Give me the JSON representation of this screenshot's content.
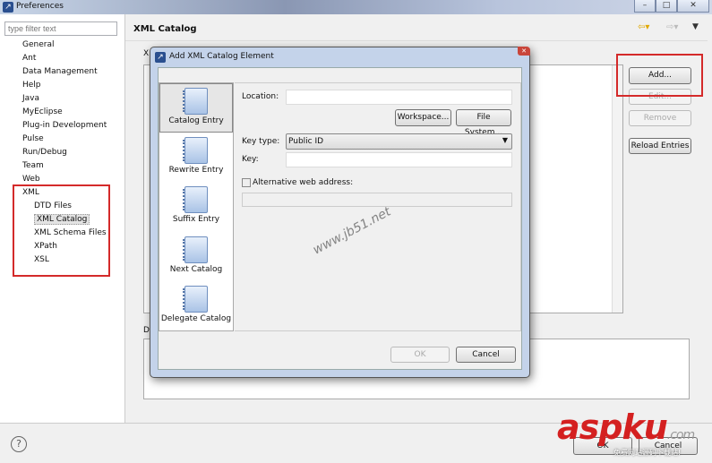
{
  "window": {
    "title": "Preferences",
    "minimize": "–",
    "maximize": "□",
    "close": "✕"
  },
  "sidebar": {
    "filter_placeholder": "type filter text",
    "items": [
      {
        "label": "General"
      },
      {
        "label": "Ant"
      },
      {
        "label": "Data Management"
      },
      {
        "label": "Help"
      },
      {
        "label": "Java"
      },
      {
        "label": "MyEclipse"
      },
      {
        "label": "Plug-in Development"
      },
      {
        "label": "Pulse"
      },
      {
        "label": "Run/Debug"
      },
      {
        "label": "Team"
      },
      {
        "label": "Web"
      },
      {
        "label": "XML"
      }
    ],
    "xml_children": [
      {
        "label": "DTD Files"
      },
      {
        "label": "XML Catalog",
        "selected": true
      },
      {
        "label": "XML Schema Files"
      },
      {
        "label": "XPath"
      },
      {
        "label": "XSL"
      }
    ]
  },
  "page": {
    "title": "XML Catalog",
    "entries_label_fragment": "X",
    "details_label_fragment": "D",
    "buttons": {
      "add": "Add...",
      "edit": "Edit...",
      "remove": "Remove",
      "reload": "Reload Entries"
    }
  },
  "footer": {
    "help": "?",
    "ok": "OK",
    "cancel": "Cancel"
  },
  "dialog": {
    "title": "Add XML Catalog Element",
    "close": "✕",
    "types": [
      {
        "label": "Catalog Entry",
        "selected": true
      },
      {
        "label": "Rewrite Entry"
      },
      {
        "label": "Suffix Entry"
      },
      {
        "label": "Next Catalog"
      },
      {
        "label": "Delegate Catalog"
      }
    ],
    "location_label": "Location:",
    "location_value": "",
    "workspace_button": "Workspace...",
    "filesystem_button": "File System...",
    "key_type_label": "Key type:",
    "key_type_value": "Public ID",
    "key_label": "Key:",
    "key_value": "",
    "alt_web_label": "Alternative web address:",
    "alt_web_checked": false,
    "alt_web_value": "",
    "ok": "OK",
    "cancel": "Cancel"
  },
  "watermarks": {
    "center": "www.jb51.net",
    "logo": "aspku",
    "logo_suffix": ".com",
    "logo_sub": "免费网站源码下载站!"
  },
  "colors": {
    "highlight": "#d42a2a",
    "dialog_frame": "#c4d3ea"
  }
}
